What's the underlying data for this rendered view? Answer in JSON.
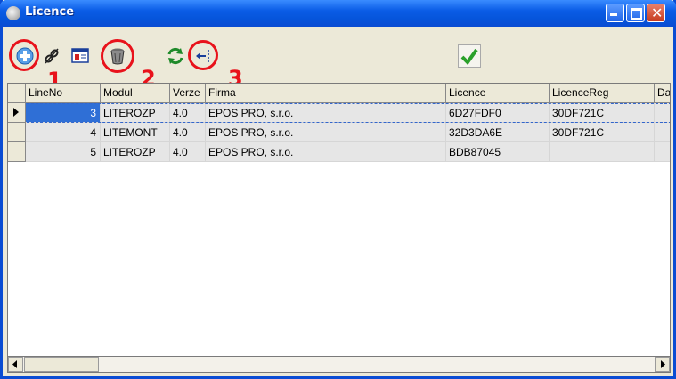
{
  "window": {
    "title": "Licence"
  },
  "toolbar": {
    "icons": [
      "add-icon",
      "link-icon",
      "card-icon",
      "delete-icon",
      "refresh-icon",
      "import-icon",
      "confirm-icon"
    ],
    "annotations": [
      "1",
      "2",
      "3"
    ]
  },
  "grid": {
    "columns": [
      "LineNo",
      "Modul",
      "Verze",
      "Firma",
      "Licence",
      "LicenceReg",
      "Dat"
    ],
    "rows": [
      {
        "LineNo": "3",
        "Modul": "LITEROZP",
        "Verze": "4.0",
        "Firma": "EPOS PRO, s.r.o.",
        "Licence": "6D27FDF0",
        "LicenceReg": "30DF721C",
        "Dat": ""
      },
      {
        "LineNo": "4",
        "Modul": "LITEMONT",
        "Verze": "4.0",
        "Firma": "EPOS PRO, s.r.o.",
        "Licence": "32D3DA6E",
        "LicenceReg": "30DF721C",
        "Dat": ""
      },
      {
        "LineNo": "5",
        "Modul": "LITEROZP",
        "Verze": "4.0",
        "Firma": "EPOS PRO, s.r.o.",
        "Licence": "BDB87045",
        "LicenceReg": "",
        "Dat": ""
      }
    ]
  },
  "colors": {
    "titlebar": "#0A5CE6",
    "selection": "#2F6FD6",
    "annotation": "#E8121B"
  }
}
